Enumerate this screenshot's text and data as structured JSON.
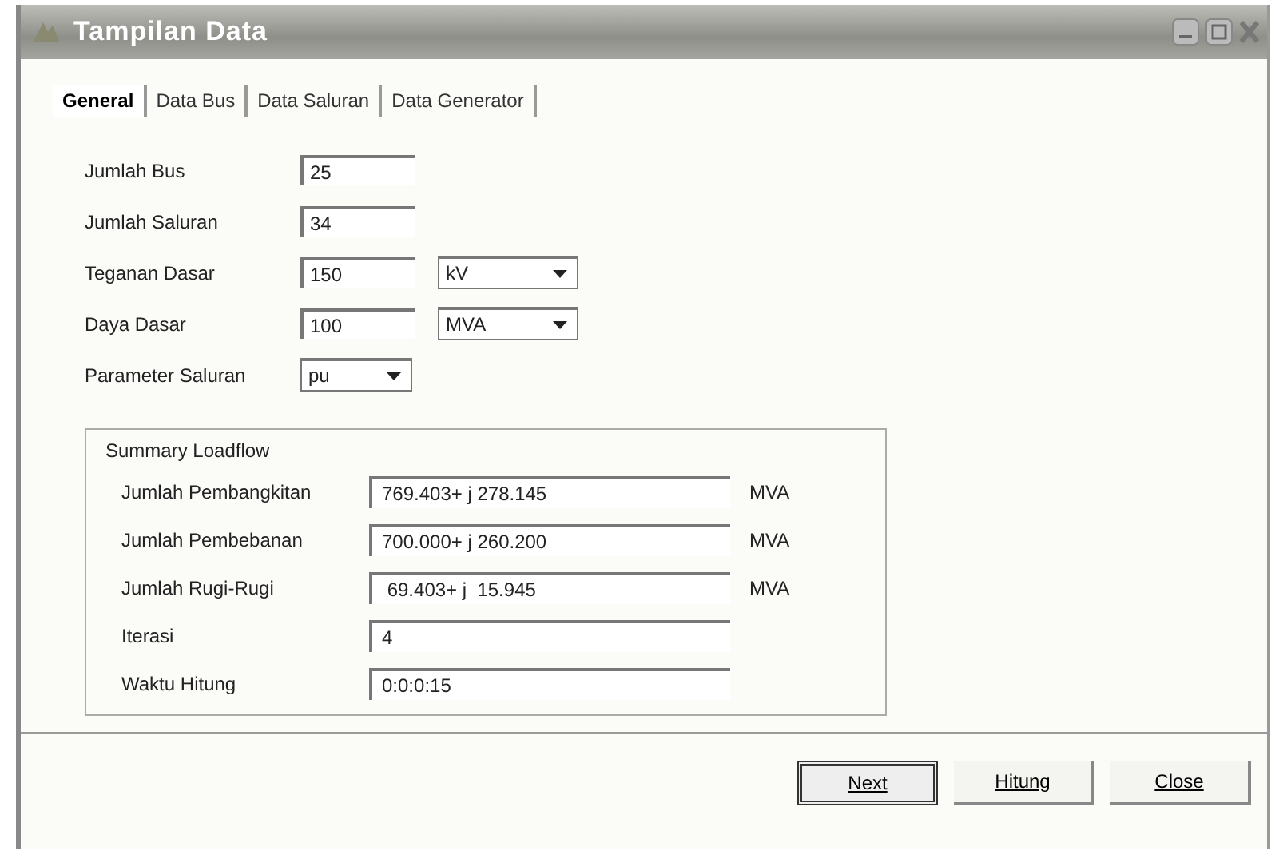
{
  "window": {
    "title": "Tampilan Data"
  },
  "tabs": [
    {
      "label": "General",
      "selected": true
    },
    {
      "label": "Data Bus",
      "selected": false
    },
    {
      "label": "Data Saluran",
      "selected": false
    },
    {
      "label": "Data Generator",
      "selected": false
    }
  ],
  "fields": [
    {
      "kind": "text",
      "label": "Jumlah Bus",
      "value": "25"
    },
    {
      "kind": "text",
      "label": "Jumlah Saluran",
      "value": "34"
    },
    {
      "kind": "text_select",
      "label": "Teganan Dasar",
      "value": "150",
      "unit": "kV"
    },
    {
      "kind": "text_select",
      "label": "Daya Dasar",
      "value": "100",
      "unit": "MVA"
    },
    {
      "kind": "select",
      "label": "Parameter Saluran",
      "value": "pu"
    }
  ],
  "summary": {
    "title": "Summary Loadflow",
    "rows": [
      {
        "label": "Jumlah Pembangkitan",
        "value": "769.403+ j 278.145",
        "unit": "MVA"
      },
      {
        "label": "Jumlah Pembebanan",
        "value": "700.000+ j 260.200",
        "unit": "MVA"
      },
      {
        "label": "Jumlah Rugi-Rugi",
        "value": " 69.403+ j  15.945",
        "unit": "MVA"
      },
      {
        "label": "Iterasi",
        "value": "4"
      },
      {
        "label": "Waktu Hitung",
        "value": "0:0:0:15"
      }
    ]
  },
  "buttons": [
    {
      "label": "Next",
      "default": true
    },
    {
      "label": "Hitung",
      "default": false
    },
    {
      "label": "Close",
      "default": false
    }
  ]
}
